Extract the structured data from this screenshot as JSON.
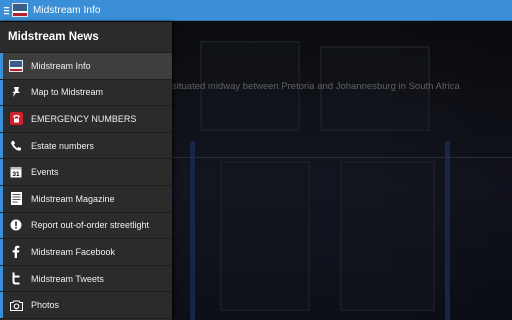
{
  "actionbar": {
    "title": "Midstream Info",
    "color": "#3a8fd6"
  },
  "drawer": {
    "header": "Midstream News",
    "items": [
      {
        "label": "Midstream Info",
        "icon": "midstream-logo-icon",
        "selected": true
      },
      {
        "label": "Map to Midstream",
        "icon": "map-pin-icon"
      },
      {
        "label": "EMERGENCY NUMBERS",
        "icon": "emergency-phone-icon"
      },
      {
        "label": "Estate numbers",
        "icon": "phone-handset-icon"
      },
      {
        "label": "Events",
        "icon": "calendar-icon"
      },
      {
        "label": "Midstream Magazine",
        "icon": "magazine-icon"
      },
      {
        "label": "Report out-of-order streetlight",
        "icon": "warning-icon"
      },
      {
        "label": "Midstream Facebook",
        "icon": "facebook-icon"
      },
      {
        "label": "Midstream Tweets",
        "icon": "twitter-icon"
      },
      {
        "label": "Photos",
        "icon": "camera-icon"
      }
    ]
  },
  "content": {
    "text": "situated midway between Pretoria and Johannesburg in South Africa"
  }
}
